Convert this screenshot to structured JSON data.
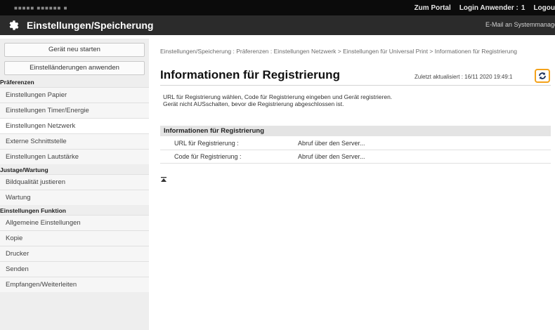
{
  "header": {
    "brand": "■■■■■ ■■■■■■ ■",
    "portal_link": "Zum Portal",
    "login_label": "Login Anwender :",
    "login_user": "1",
    "logout": "Logou",
    "title": "Einstellungen/Speicherung",
    "mail_link": "E-Mail an Systemmanage"
  },
  "sidebar": {
    "restart_button": "Gerät neu starten",
    "apply_button": "Einstelländerungen anwenden",
    "sections": [
      {
        "heading": "Präferenzen",
        "items": [
          "Einstellungen Papier",
          "Einstellungen Timer/Energie",
          "Einstellungen Netzwerk",
          "Externe Schnittstelle",
          "Einstellungen Lautstärke"
        ]
      },
      {
        "heading": "Justage/Wartung",
        "items": [
          "Bildqualität justieren",
          "Wartung"
        ]
      },
      {
        "heading": "Einstellungen Funktion",
        "items": [
          "Allgemeine Einstellungen",
          "Kopie",
          "Drucker",
          "Senden",
          "Empfangen/Weiterleiten"
        ]
      }
    ]
  },
  "main": {
    "breadcrumb": "Einstellungen/Speicherung : Präferenzen : Einstellungen Netzwerk > Einstellungen für Universal Print > Informationen für Registrierung",
    "title": "Informationen für Registrierung",
    "last_updated": "Zuletzt aktualisiert : 16/11 2020 19:49:1",
    "description_line1": "URL für Registrierung wählen, Code für Registrierung eingeben und Gerät registrieren.",
    "description_line2": "Gerät nicht AUSschalten, bevor die Registrierung abgeschlossen ist.",
    "section_title": "Informationen für Registrierung",
    "rows": [
      {
        "label": "URL für Registrierung :",
        "value": "Abruf über den Server..."
      },
      {
        "label": "Code für Registrierung :",
        "value": "Abruf über den Server..."
      }
    ]
  },
  "colors": {
    "topbar": "#0b0b0b",
    "titlebar": "#2b2b2b",
    "sidebar": "#eeeeee",
    "highlight": "#f4a21a"
  },
  "icons": {
    "settings": "gear-icon",
    "refresh": "refresh-icon",
    "back_to_top": "back-to-top-icon"
  }
}
